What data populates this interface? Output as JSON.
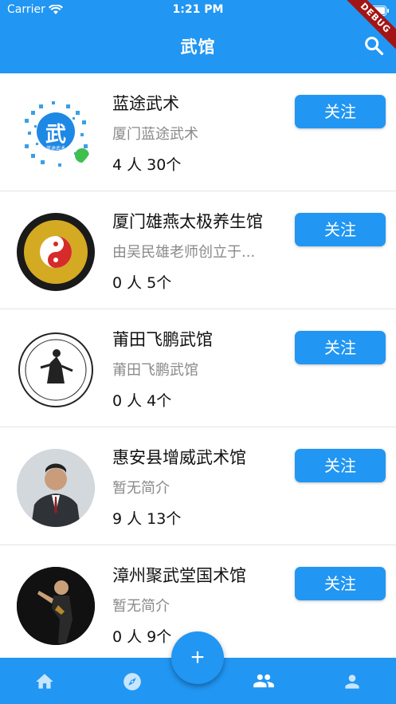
{
  "status": {
    "carrier": "Carrier",
    "time": "1:21 PM",
    "battery_level": 0.95
  },
  "header": {
    "title": "武馆",
    "debug_label": "DEBUG"
  },
  "list": [
    {
      "name": "蓝途武术",
      "desc": "厦门蓝途武术",
      "stats": "4 人   30个",
      "follow": "关注",
      "avatar_text": "武",
      "avatar_sub": "蓝途武术"
    },
    {
      "name": "厦门雄燕太极养生馆",
      "desc": "由吴民雄老师创立于...",
      "stats": "0 人   5个",
      "follow": "关注",
      "avatar_text": "",
      "avatar_sub": ""
    },
    {
      "name": "莆田飞鹏武馆",
      "desc": "莆田飞鹏武馆",
      "stats": "0 人   4个",
      "follow": "关注",
      "avatar_text": "",
      "avatar_sub": ""
    },
    {
      "name": "惠安县增威武术馆",
      "desc": "暂无简介",
      "stats": "9 人   13个",
      "follow": "关注",
      "avatar_text": "",
      "avatar_sub": ""
    },
    {
      "name": "漳州聚武堂国术馆",
      "desc": "暂无简介",
      "stats": "0 人   9个",
      "follow": "关注",
      "avatar_text": "",
      "avatar_sub": ""
    }
  ],
  "fab": {
    "label": "+"
  },
  "colors": {
    "primary": "#2196F3",
    "debug": "#a31515"
  },
  "icons": [
    "wifi-icon",
    "search-icon",
    "home-icon",
    "compass-icon",
    "people-icon",
    "person-icon",
    "add-icon"
  ]
}
